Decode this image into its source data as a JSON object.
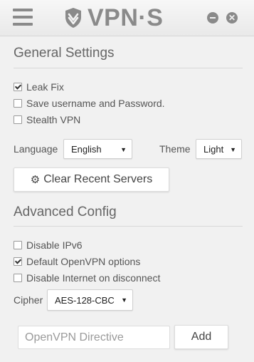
{
  "app": {
    "title": "VPN·S",
    "icons": {
      "menu": "hamburger-icon",
      "logo": "shield-v-icon",
      "minimize": "minimize-icon",
      "close": "close-icon"
    }
  },
  "general": {
    "title": "General Settings",
    "options": [
      {
        "label": "Leak Fix",
        "checked": true
      },
      {
        "label": "Save username and Password.",
        "checked": false
      },
      {
        "label": "Stealth VPN",
        "checked": false
      }
    ],
    "language_label": "Language",
    "language_value": "English",
    "theme_label": "Theme",
    "theme_value": "Light",
    "clear_button": "Clear Recent Servers"
  },
  "advanced": {
    "title": "Advanced Config",
    "options": [
      {
        "label": "Disable IPv6",
        "checked": false
      },
      {
        "label": "Default OpenVPN options",
        "checked": true
      },
      {
        "label": "Disable Internet on disconnect",
        "checked": false
      }
    ],
    "cipher_label": "Cipher",
    "cipher_value": "AES-128-CBC",
    "directive_placeholder": "OpenVPN Directive",
    "add_button": "Add"
  }
}
